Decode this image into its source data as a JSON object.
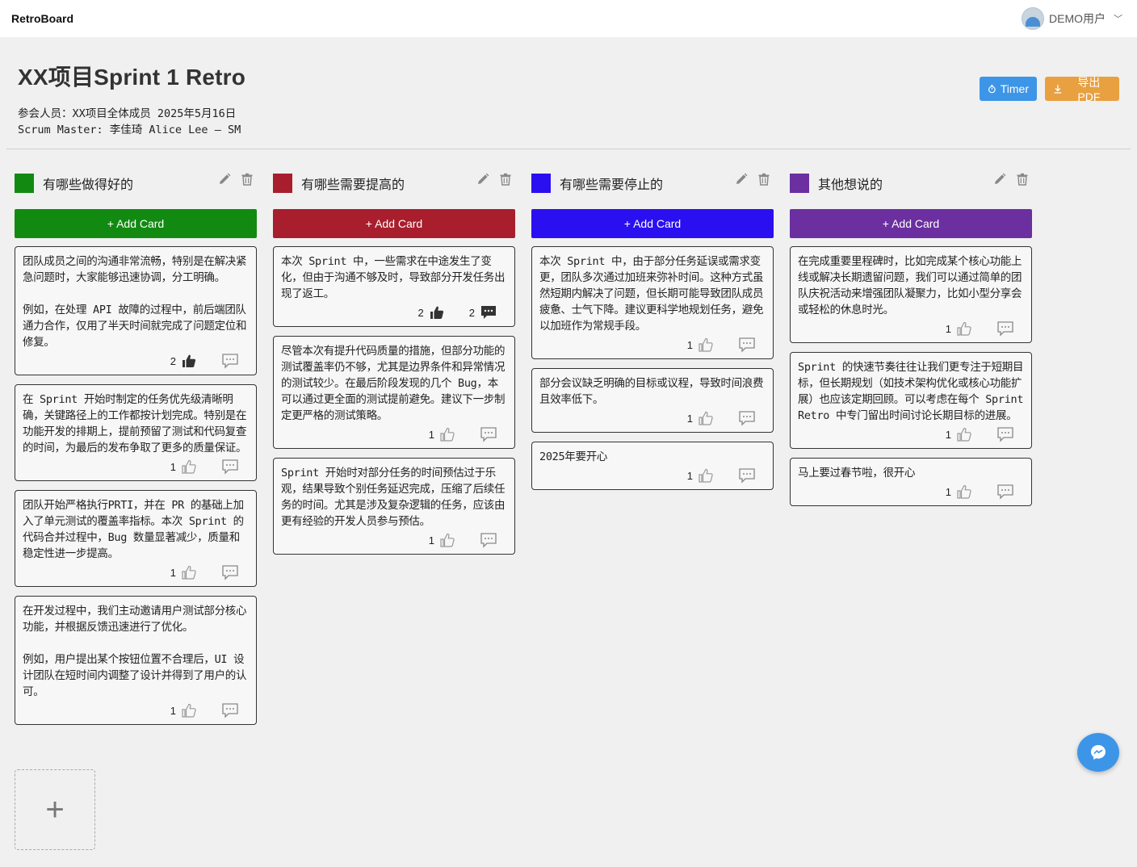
{
  "app": {
    "brand": "RetroBoard",
    "user_name": "DEMO用户"
  },
  "header": {
    "title": "XX项目Sprint 1 Retro",
    "meta_line1": "参会人员：XX项目全体成员 2025年5月16日",
    "meta_line2": "Scrum Master: 李佳琦 Alice Lee – SM",
    "timer_label": "Timer",
    "export_label": "导出PDF"
  },
  "add_card_label": "+ Add Card",
  "add_column_label": "+",
  "columns": [
    {
      "title": "有哪些做得好的",
      "color": "#128a12",
      "cards": [
        {
          "text": "团队成员之间的沟通非常流畅，特别是在解决紧急问题时，大家能够迅速协调，分工明确。\n\n例如，在处理 API 故障的过程中，前后端团队通力合作，仅用了半天时间就完成了问题定位和修复。",
          "likes": "2",
          "liked": true,
          "comments": "",
          "commented": false
        },
        {
          "text": "在 Sprint 开始时制定的任务优先级清晰明确，关键路径上的工作都按计划完成。特别是在功能开发的排期上，提前预留了测试和代码复查的时间，为最后的发布争取了更多的质量保证。",
          "likes": "1",
          "liked": false,
          "comments": "",
          "commented": false
        },
        {
          "text": "团队开始严格执行PRTI，并在 PR 的基础上加入了单元测试的覆盖率指标。本次 Sprint 的代码合并过程中，Bug 数量显著减少，质量和稳定性进一步提高。",
          "likes": "1",
          "liked": false,
          "comments": "",
          "commented": false
        },
        {
          "text": "在开发过程中，我们主动邀请用户测试部分核心功能，并根据反馈迅速进行了优化。\n\n例如，用户提出某个按钮位置不合理后，UI 设计团队在短时间内调整了设计并得到了用户的认可。",
          "likes": "1",
          "liked": false,
          "comments": "",
          "commented": false
        }
      ]
    },
    {
      "title": "有哪些需要提高的",
      "color": "#a81e2d",
      "cards": [
        {
          "text": "本次 Sprint 中，一些需求在中途发生了变化，但由于沟通不够及时，导致部分开发任务出现了返工。",
          "likes": "2",
          "liked": true,
          "comments": "2",
          "commented": true
        },
        {
          "text": "尽管本次有提升代码质量的措施，但部分功能的测试覆盖率仍不够，尤其是边界条件和异常情况的测试较少。在最后阶段发现的几个 Bug，本可以通过更全面的测试提前避免。建议下一步制定更严格的测试策略。",
          "likes": "1",
          "liked": false,
          "comments": "",
          "commented": false
        },
        {
          "text": "Sprint 开始时对部分任务的时间预估过于乐观，结果导致个别任务延迟完成，压缩了后续任务的时间。尤其是涉及复杂逻辑的任务，应该由更有经验的开发人员参与预估。",
          "likes": "1",
          "liked": false,
          "comments": "",
          "commented": false
        }
      ]
    },
    {
      "title": "有哪些需要停止的",
      "color": "#2a0ff0",
      "cards": [
        {
          "text": "本次 Sprint 中，由于部分任务延误或需求变更，团队多次通过加班来弥补时间。这种方式虽然短期内解决了问题，但长期可能导致团队成员疲惫、士气下降。建议更科学地规划任务，避免以加班作为常规手段。",
          "likes": "1",
          "liked": false,
          "comments": "",
          "commented": false
        },
        {
          "text": "部分会议缺乏明确的目标或议程，导致时间浪费且效率低下。",
          "likes": "1",
          "liked": false,
          "comments": "",
          "commented": false
        },
        {
          "text": "2025年要开心",
          "likes": "1",
          "liked": false,
          "comments": "",
          "commented": false
        }
      ]
    },
    {
      "title": "其他想说的",
      "color": "#6b2fa0",
      "cards": [
        {
          "text": "在完成重要里程碑时，比如完成某个核心功能上线或解决长期遗留问题，我们可以通过简单的团队庆祝活动来增强团队凝聚力，比如小型分享会或轻松的休息时光。",
          "likes": "1",
          "liked": false,
          "comments": "",
          "commented": false
        },
        {
          "text": "Sprint 的快速节奏往往让我们更专注于短期目标，但长期规划（如技术架构优化或核心功能扩展）也应该定期回顾。可以考虑在每个 Sprint Retro 中专门留出时间讨论长期目标的进展。",
          "likes": "1",
          "liked": false,
          "comments": "",
          "commented": false
        },
        {
          "text": "马上要过春节啦，很开心",
          "likes": "1",
          "liked": false,
          "comments": "",
          "commented": false
        }
      ]
    }
  ]
}
